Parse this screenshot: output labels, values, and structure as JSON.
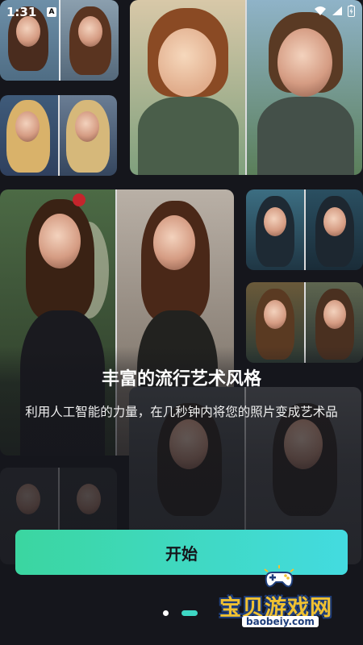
{
  "status_bar": {
    "time": "1:31"
  },
  "onboarding": {
    "headline": "丰富的流行艺术风格",
    "subtitle": "利用人工智能的力量，在几秒钟内将您的照片变成艺术品",
    "start_button": "开始",
    "page_indicator": {
      "total": 2,
      "current": 2
    }
  },
  "watermark": {
    "title": "宝贝游戏网",
    "url": "baobeiy.com"
  },
  "colors": {
    "background": "#15161c",
    "button_gradient_start": "#3bd6a0",
    "button_gradient_end": "#43dbe0",
    "active_dot": "#3ed7c4"
  }
}
